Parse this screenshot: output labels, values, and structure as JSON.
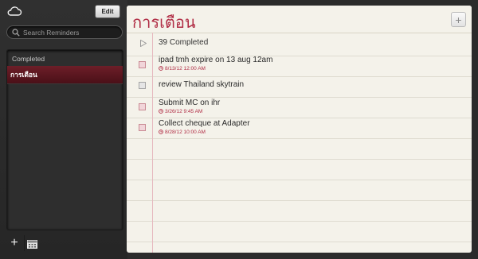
{
  "toolbar": {
    "edit_label": "Edit"
  },
  "search": {
    "placeholder": "Search Reminders"
  },
  "sidebar": {
    "completed_label": "Completed",
    "lists": [
      {
        "label": "การเตือน",
        "selected": true
      }
    ]
  },
  "main": {
    "title": "การเตือน",
    "completed_summary": "39 Completed",
    "items": [
      {
        "title": "ipad tmh expire on 13 aug 12am",
        "due": "8/13/12 12:00 AM"
      },
      {
        "title": "review Thailand skytrain",
        "due": ""
      },
      {
        "title": "Submit MC on ihr",
        "due": "3/26/12 9:45 AM"
      },
      {
        "title": "Collect cheque at Adapter",
        "due": "8/28/12 10:00 AM"
      }
    ]
  },
  "colors": {
    "accent": "#b02c44",
    "selected_list": "#5e1620",
    "paper": "#f4f2ea"
  },
  "icons": {
    "cloud": "cloud-icon",
    "search": "search-icon",
    "add": "plus-icon",
    "calendar": "calendar-icon",
    "disclosure": "triangle-right-icon",
    "alarm": "clock-icon"
  }
}
